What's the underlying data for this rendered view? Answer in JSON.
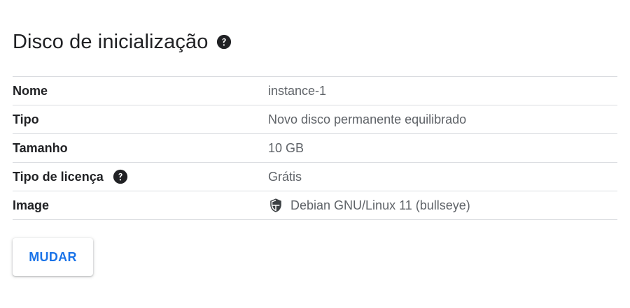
{
  "section": {
    "title": "Disco de inicialização",
    "title_help_icon": "help-circle-icon"
  },
  "rows": [
    {
      "label": "Nome",
      "value": "instance-1"
    },
    {
      "label": "Tipo",
      "value": "Novo disco permanente equilibrado"
    },
    {
      "label": "Tamanho",
      "value": "10 GB"
    },
    {
      "label": "Tipo de licença",
      "value": "Grátis",
      "label_icon": "help-circle-icon"
    },
    {
      "label": "Image",
      "value": "Debian GNU/Linux 11 (bullseye)",
      "value_icon": "shield-icon"
    }
  ],
  "actions": {
    "change_label": "MUDAR"
  },
  "colors": {
    "accent": "#1a73e8",
    "text_primary": "#202124",
    "text_secondary": "#5f6368",
    "divider": "#dadce0"
  }
}
